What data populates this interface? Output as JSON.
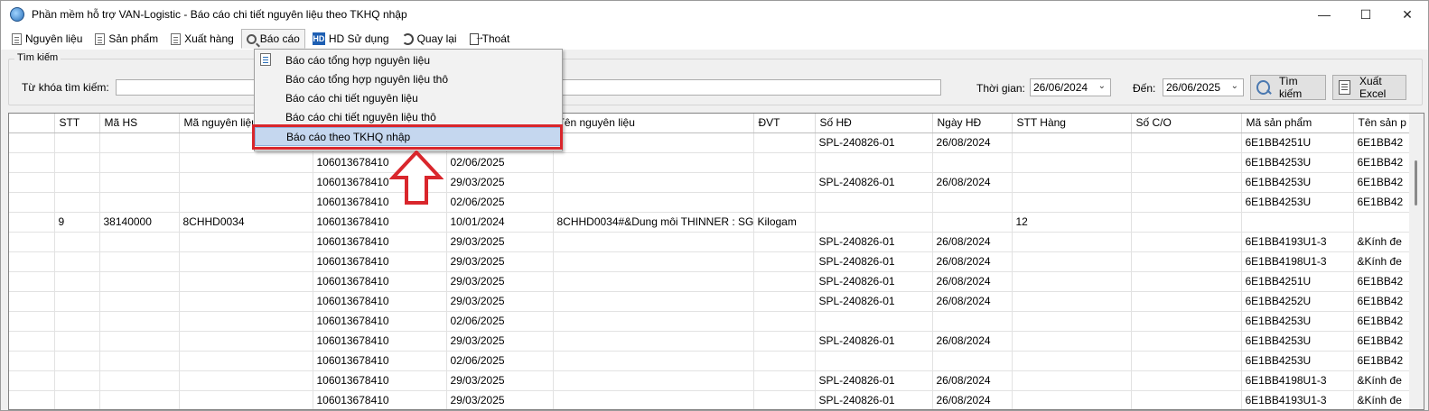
{
  "window": {
    "title": "Phần mềm hỗ trợ VAN-Logistic - Báo cáo chi tiết nguyên liệu theo TKHQ nhập"
  },
  "menu": {
    "items": [
      {
        "label": "Nguyên liệu",
        "icon": "document-icon"
      },
      {
        "label": "Sản phẩm",
        "icon": "document-icon"
      },
      {
        "label": "Xuất hàng",
        "icon": "document-icon"
      },
      {
        "label": "Báo cáo",
        "icon": "search-icon",
        "active": true
      },
      {
        "label": "HD Sử dụng",
        "icon": "help-icon"
      },
      {
        "label": "Quay lại",
        "icon": "back-icon"
      },
      {
        "label": "Thoát",
        "icon": "exit-icon"
      }
    ]
  },
  "dropdown": {
    "items": [
      "Báo cáo tổng hợp nguyên liệu",
      "Báo cáo tổng hợp nguyên liệu thô",
      "Báo cáo chi tiết nguyên liệu",
      "Báo cáo chi tiết nguyên liệu thô",
      "Báo cáo theo TKHQ nhập"
    ],
    "highlighted_index": 4,
    "highlight_color": "#d9262c"
  },
  "search": {
    "group_title": "Tìm kiếm",
    "keyword_label": "Từ khóa tìm kiếm:",
    "keyword_value": "",
    "time_label": "Thời gian:",
    "from_date": "26/06/2024",
    "to_label": "Đến:",
    "to_date": "26/06/2025",
    "search_button": "Tìm kiếm",
    "export_button": "Xuất Excel"
  },
  "grid": {
    "columns": [
      "",
      "STT",
      "Mã HS",
      "Mã nguyên liệu",
      "",
      "",
      "Tên nguyên liệu",
      "ĐVT",
      "Số HĐ",
      "Ngày HĐ",
      "STT Hàng",
      "Số C/O",
      "Mã sản phẩm",
      "Tên sản p"
    ],
    "rows": [
      [
        "",
        "",
        "",
        "",
        "",
        "",
        "",
        "",
        "SPL-240826-01",
        "26/08/2024",
        "",
        "",
        "6E1BB4251U",
        "6E1BB42"
      ],
      [
        "",
        "",
        "",
        "",
        "106013678410",
        "02/06/2025",
        "",
        "",
        "",
        "",
        "",
        "",
        "6E1BB4253U",
        "6E1BB42"
      ],
      [
        "",
        "",
        "",
        "",
        "106013678410",
        "29/03/2025",
        "",
        "",
        "SPL-240826-01",
        "26/08/2024",
        "",
        "",
        "6E1BB4253U",
        "6E1BB42"
      ],
      [
        "",
        "",
        "",
        "",
        "106013678410",
        "02/06/2025",
        "",
        "",
        "",
        "",
        "",
        "",
        "6E1BB4253U",
        "6E1BB42"
      ],
      [
        "",
        "9",
        "38140000",
        "8CHHD0034",
        "106013678410",
        "10/01/2024",
        "8CHHD0034#&Dung môi THINNER : SG ...",
        "Kilogam",
        "",
        "",
        "12",
        "",
        "",
        ""
      ],
      [
        "",
        "",
        "",
        "",
        "106013678410",
        "29/03/2025",
        "",
        "",
        "SPL-240826-01",
        "26/08/2024",
        "",
        "",
        "6E1BB4193U1-3",
        "&Kính đe"
      ],
      [
        "",
        "",
        "",
        "",
        "106013678410",
        "29/03/2025",
        "",
        "",
        "SPL-240826-01",
        "26/08/2024",
        "",
        "",
        "6E1BB4198U1-3",
        "&Kính đe"
      ],
      [
        "",
        "",
        "",
        "",
        "106013678410",
        "29/03/2025",
        "",
        "",
        "SPL-240826-01",
        "26/08/2024",
        "",
        "",
        "6E1BB4251U",
        "6E1BB42"
      ],
      [
        "",
        "",
        "",
        "",
        "106013678410",
        "29/03/2025",
        "",
        "",
        "SPL-240826-01",
        "26/08/2024",
        "",
        "",
        "6E1BB4252U",
        "6E1BB42"
      ],
      [
        "",
        "",
        "",
        "",
        "106013678410",
        "02/06/2025",
        "",
        "",
        "",
        "",
        "",
        "",
        "6E1BB4253U",
        "6E1BB42"
      ],
      [
        "",
        "",
        "",
        "",
        "106013678410",
        "29/03/2025",
        "",
        "",
        "SPL-240826-01",
        "26/08/2024",
        "",
        "",
        "6E1BB4253U",
        "6E1BB42"
      ],
      [
        "",
        "",
        "",
        "",
        "106013678410",
        "02/06/2025",
        "",
        "",
        "",
        "",
        "",
        "",
        "6E1BB4253U",
        "6E1BB42"
      ],
      [
        "",
        "",
        "",
        "",
        "106013678410",
        "29/03/2025",
        "",
        "",
        "SPL-240826-01",
        "26/08/2024",
        "",
        "",
        "6E1BB4198U1-3",
        "&Kính đe"
      ],
      [
        "",
        "",
        "",
        "",
        "106013678410",
        "29/03/2025",
        "",
        "",
        "SPL-240826-01",
        "26/08/2024",
        "",
        "",
        "6E1BB4193U1-3",
        "&Kính đe"
      ]
    ]
  }
}
